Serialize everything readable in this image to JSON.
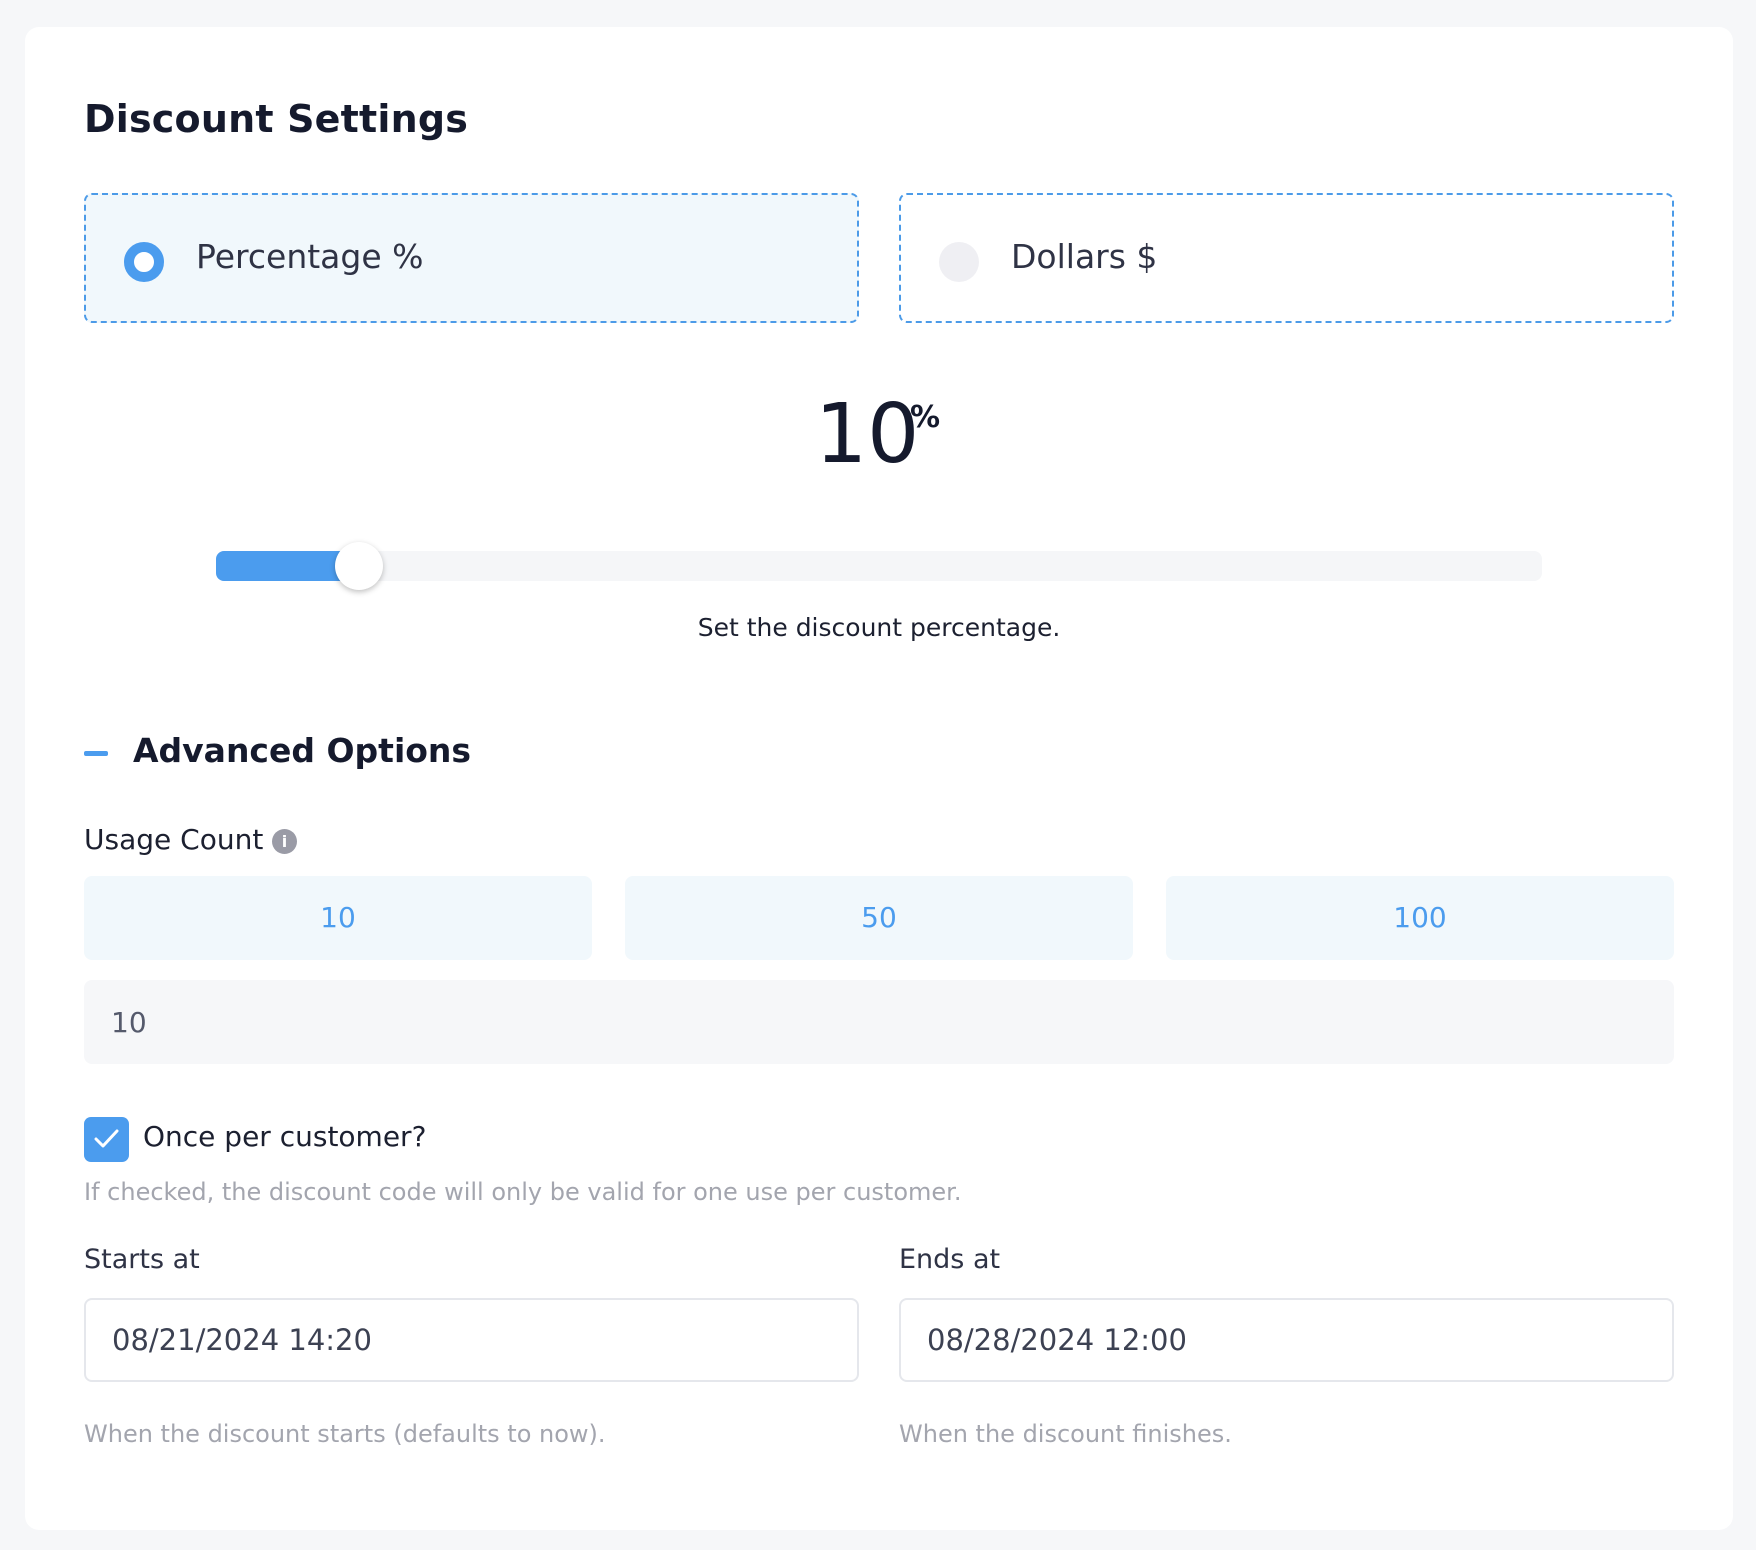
{
  "title": "Discount Settings",
  "discount_type": {
    "options": [
      {
        "label": "Percentage %",
        "selected": true
      },
      {
        "label": "Dollars $",
        "selected": false
      }
    ]
  },
  "amount": {
    "value": "10",
    "unit": "%",
    "slider_fraction": 0.1,
    "help": "Set the discount percentage."
  },
  "advanced": {
    "title": "Advanced Options",
    "usage_count": {
      "label": "Usage Count",
      "info_icon": "info-icon",
      "presets": [
        "10",
        "50",
        "100"
      ],
      "value": "10"
    },
    "once_per_customer": {
      "label": "Once per customer?",
      "checked": true,
      "help": "If checked, the discount code will only be valid for one use per customer."
    },
    "starts_at": {
      "label": "Starts at",
      "value": "08/21/2024 14:20",
      "help": "When the discount starts (defaults to now)."
    },
    "ends_at": {
      "label": "Ends at",
      "value": "08/28/2024 12:00",
      "help": "When the discount finishes."
    }
  },
  "colors": {
    "accent": "#4b9cee",
    "selected_bg": "#f1f8fc",
    "text": "#151a2d",
    "muted": "#a3a5ae"
  }
}
